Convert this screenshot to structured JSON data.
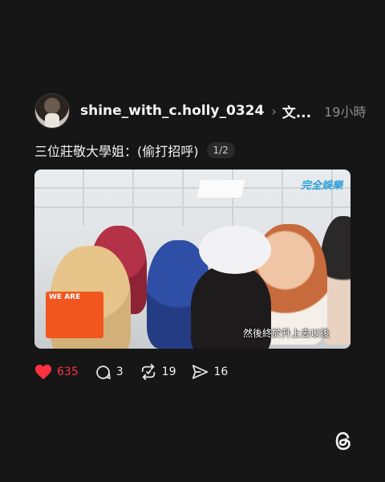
{
  "post": {
    "username": "shine_with_c.holly_0324",
    "topic": "文...",
    "time": "19小時",
    "caption": "三位莊敬大學姐：(偷打招呼)",
    "page_indicator": "1/2",
    "media": {
      "subtitle": "然後終於升上去以後",
      "brand_text": "完全娛樂",
      "logo_text": "WE ARE"
    }
  },
  "actions": {
    "likes": "635",
    "comments": "3",
    "reposts": "19",
    "shares": "16"
  },
  "colors": {
    "background": "#161616",
    "like": "#ff3040"
  },
  "icons": [
    "heart-icon",
    "comment-icon",
    "repost-icon",
    "share-icon",
    "threads-logo-icon",
    "chevron-right-icon"
  ]
}
